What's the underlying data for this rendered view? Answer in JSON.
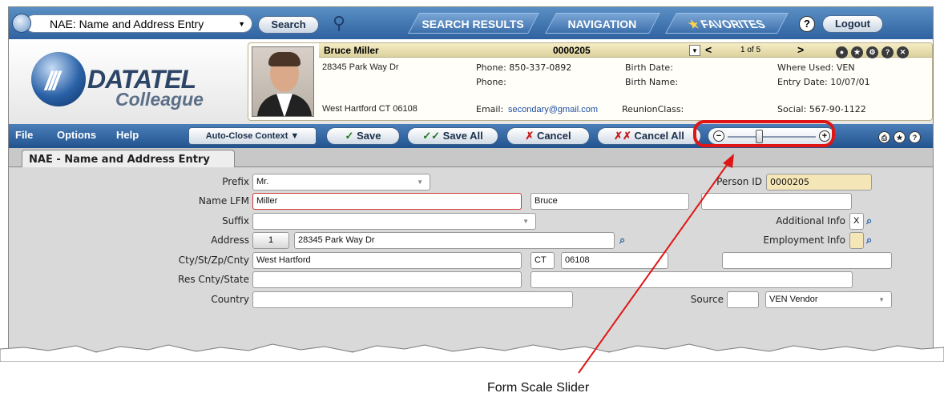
{
  "topbar": {
    "form_select": "NAE: Name and Address Entry",
    "search_label": "Search",
    "tabs": [
      "SEARCH RESULTS",
      "NAVIGATION",
      "FAVORITES"
    ],
    "help": "?",
    "logout_label": "Logout"
  },
  "logo": {
    "brand": "DATATEL",
    "product": "Colleague"
  },
  "person": {
    "name": "Bruce Miller",
    "id": "0000205",
    "pager": "1 of 5",
    "address1": "28345 Park Way Dr",
    "city_line": "West Hartford CT 06108",
    "phone1": "Phone: 850-337-0892",
    "phone2": "Phone:",
    "email_label": "Email:",
    "email": "secondary@gmail.com",
    "birth_date": "Birth Date:",
    "birth_name": "Birth Name:",
    "reunion_class": "ReunionClass:",
    "where_used": "Where Used: VEN",
    "entry_date": "Entry Date: 10/07/01",
    "social": "Social: 567-90-1122"
  },
  "toolbar": {
    "file": "File",
    "options": "Options",
    "help": "Help",
    "auto_close": "Auto-Close Context ▼",
    "save": "Save",
    "save_all": "Save All",
    "cancel": "Cancel",
    "cancel_all": "Cancel All",
    "slider_minus": "−",
    "slider_plus": "+",
    "slider_value": 0.35
  },
  "tab": {
    "label": "NAE - Name and Address Entry"
  },
  "form": {
    "prefix_label": "Prefix",
    "prefix_value": "Mr.",
    "name_label": "Name LFM",
    "last_name": "Miller",
    "first_name": "Bruce",
    "middle_name": "",
    "suffix_label": "Suffix",
    "suffix_value": "",
    "address_label": "Address",
    "address_index": "1",
    "address_value": "28345 Park Way Dr",
    "city_label": "Cty/St/Zp/Cnty",
    "city": "West Hartford",
    "state": "CT",
    "zip": "06108",
    "county": "",
    "res_label": "Res Cnty/State",
    "country_label": "Country",
    "person_id_label": "Person ID",
    "person_id": "0000205",
    "additional_info_label": "Additional Info",
    "additional_info_value": "X",
    "employment_info_label": "Employment Info",
    "source_label": "Source",
    "source_value": "VEN Vendor"
  },
  "annotation": {
    "caption": "Form Scale Slider",
    "color": "#e01515"
  }
}
